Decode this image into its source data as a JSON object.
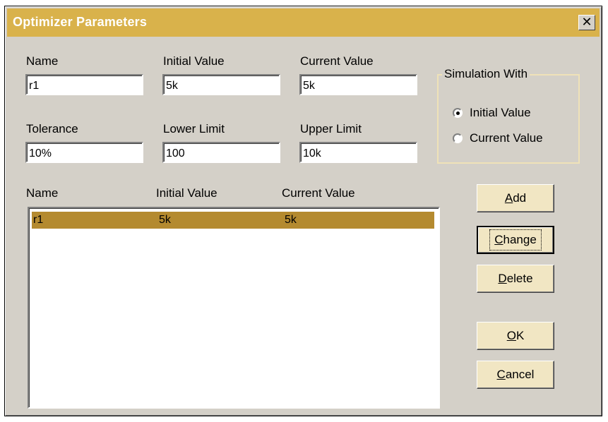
{
  "window": {
    "title": "Optimizer Parameters",
    "close_glyph": "✕"
  },
  "fields": {
    "name": {
      "label": "Name",
      "value": "r1"
    },
    "initial_value": {
      "label": "Initial Value",
      "value": "5k"
    },
    "current_value": {
      "label": "Current Value",
      "value": "5k"
    },
    "tolerance": {
      "label": "Tolerance",
      "value": "10%"
    },
    "lower_limit": {
      "label": "Lower Limit",
      "value": "100"
    },
    "upper_limit": {
      "label": "Upper Limit",
      "value": "10k"
    }
  },
  "simulation": {
    "title": "Simulation With",
    "options": [
      {
        "label": "Initial Value",
        "selected": true
      },
      {
        "label": "Current Value",
        "selected": false
      }
    ]
  },
  "list": {
    "columns": [
      "Name",
      "Initial Value",
      "Current Value"
    ],
    "rows": [
      {
        "name": "r1",
        "initial": "5k",
        "current": "5k",
        "selected": true
      }
    ]
  },
  "buttons": {
    "add": {
      "mnemonic": "A",
      "rest": "dd"
    },
    "change": {
      "mnemonic": "C",
      "rest": "hange"
    },
    "delete": {
      "mnemonic": "D",
      "rest": "elete"
    },
    "ok": {
      "mnemonic": "O",
      "rest": "K"
    },
    "cancel": {
      "mnemonic": "C",
      "rest": "ancel"
    }
  },
  "colors": {
    "titlebar": "#d9b24b",
    "selection": "#b48a2f",
    "button_face": "#f1e6c3"
  }
}
